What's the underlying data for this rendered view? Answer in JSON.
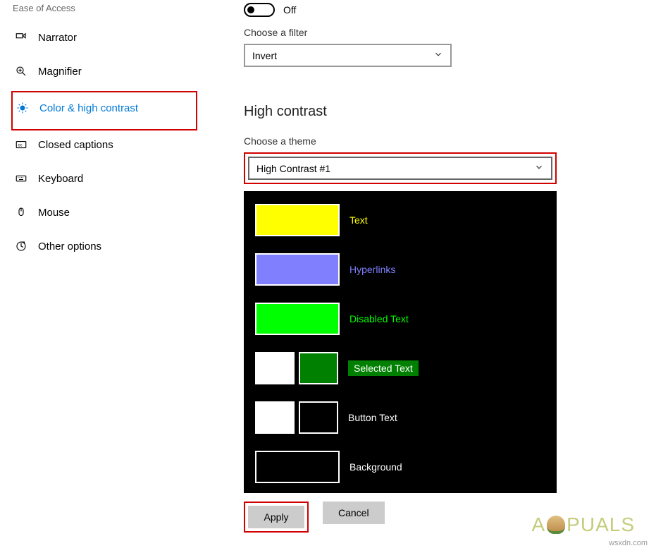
{
  "sidebar": {
    "header": "Ease of Access",
    "items": [
      {
        "label": "Narrator"
      },
      {
        "label": "Magnifier"
      },
      {
        "label": "Color & high contrast"
      },
      {
        "label": "Closed captions"
      },
      {
        "label": "Keyboard"
      },
      {
        "label": "Mouse"
      },
      {
        "label": "Other options"
      }
    ]
  },
  "toggle": {
    "state": "Off"
  },
  "filter": {
    "label": "Choose a filter",
    "value": "Invert"
  },
  "high_contrast": {
    "title": "High contrast",
    "theme_label": "Choose a theme",
    "theme_value": "High Contrast #1",
    "preview": {
      "text": {
        "label": "Text",
        "color": "#ffff00",
        "label_color": "#ffff00"
      },
      "hyperlinks": {
        "label": "Hyperlinks",
        "color": "#8080ff",
        "label_color": "#8080ff"
      },
      "disabled": {
        "label": "Disabled Text",
        "color": "#00ff00",
        "label_color": "#00ff00"
      },
      "selected": {
        "label": "Selected Text",
        "fg": "#ffffff",
        "bg": "#008000",
        "label_color": "#ffffff",
        "label_bg": "#008000"
      },
      "button": {
        "label": "Button Text",
        "fg": "#ffffff",
        "bg": "#000000",
        "label_color": "#ffffff"
      },
      "background": {
        "label": "Background",
        "color": "#000000",
        "label_color": "#ffffff"
      }
    }
  },
  "buttons": {
    "apply": "Apply",
    "cancel": "Cancel"
  },
  "watermark": "wsxdn.com",
  "logo": {
    "before": "A",
    "after": "PUALS"
  }
}
